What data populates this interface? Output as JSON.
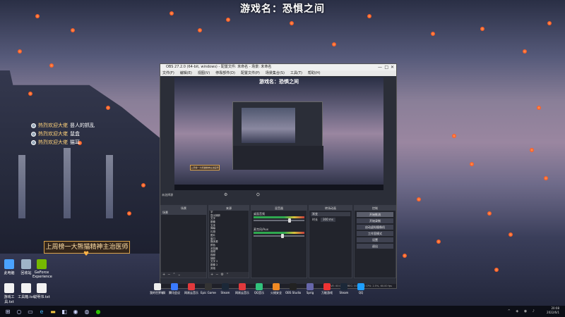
{
  "stream": {
    "top_title": "游戏名：恐惧之间",
    "banner_text": "上周榜一大熊猫精神主治医师",
    "banner_heart": "♥"
  },
  "chat": [
    {
      "user": "热烈欢迎大佬",
      "msg": "昙人的抓乱"
    },
    {
      "user": "热烈欢迎大佬",
      "msg": "鼠盒"
    },
    {
      "user": "热烈欢迎大佬",
      "msg": "猫耳"
    }
  ],
  "desktop_icons": [
    {
      "label": "此电脑",
      "color": "#4aa3ff"
    },
    {
      "label": "回收站",
      "color": "#9fb4c8"
    },
    {
      "label": "GeForce Experience",
      "color": "#76b900"
    },
    {
      "label": "游戏工具.txt",
      "color": "#f2f2f2"
    },
    {
      "label": "工具箱.txt",
      "color": "#f2f2f2"
    },
    {
      "label": "说明书.txt",
      "color": "#f2f2f2"
    }
  ],
  "obs": {
    "titlebar": "OBS 27.2.0 (64-bit, windows) - 配置文件: 未命名 - 场景: 未命名",
    "menu": [
      "文件(F)",
      "编辑(E)",
      "视图(V)",
      "停靠部件(D)",
      "配置文件(P)",
      "场景集合(S)",
      "工具(T)",
      "帮助(H)"
    ],
    "preview_title": "游戏名：恐惧之间",
    "status_left": "未选择源",
    "docks": {
      "scenes": {
        "title": "场景",
        "items": [
          "场景"
        ]
      },
      "sources": {
        "title": "来源",
        "items": [
          "字",
          "显示捕获",
          "文字",
          "图像",
          "文本",
          "弹幕",
          "礼物",
          "图片",
          "窗口",
          "媒体源",
          "颜色",
          "浏览器",
          "音频",
          "视频",
          "捕获",
          "文字 2",
          "图像 2",
          "其他"
        ]
      },
      "mixer": {
        "title": "混音器",
        "tracks": [
          {
            "name": "桌面音频",
            "level": 0.7
          },
          {
            "name": "麦克风/Aux",
            "level": 0.55
          }
        ]
      },
      "transitions": {
        "title": "转场动画",
        "fade": "渐变",
        "duration_label": "时长",
        "duration": "300 ms"
      },
      "controls": {
        "title": "控制",
        "buttons": [
          "开始推流",
          "开始录制",
          "启动虚拟摄像机",
          "工作室模式",
          "设置",
          "退出"
        ]
      }
    },
    "bottom_status": "LIVE: 00:00:00  REC: 00:00:00  CPU: 2.5%, 60.00 fps"
  },
  "dock_apps": [
    {
      "label": "我的世界辅助",
      "color": "#eee"
    },
    {
      "label": "腾讯会议",
      "color": "#3a7bff"
    },
    {
      "label": "网易云音乐",
      "color": "#e2393c"
    },
    {
      "label": "Epic Games Launcher",
      "color": "#333"
    },
    {
      "label": "Steam",
      "color": "#1b2838"
    },
    {
      "label": "网易云音乐",
      "color": "#e2393c"
    },
    {
      "label": "QQ音乐",
      "color": "#31c27c"
    },
    {
      "label": "火绒安全",
      "color": "#f08a24"
    },
    {
      "label": "OBS Studio",
      "color": "#222"
    },
    {
      "label": "Sprig",
      "color": "#66a"
    },
    {
      "label": "万能游戏",
      "color": "#e33"
    },
    {
      "label": "Steam",
      "color": "#1b2838"
    },
    {
      "label": "QQ",
      "color": "#1e9fff"
    }
  ],
  "taskbar": {
    "clock_time": "20:08",
    "clock_date": "2022/6/1",
    "icons": [
      "windows-icon",
      "search-icon",
      "task-view-icon",
      "edge-icon",
      "folder-icon",
      "store-icon",
      "obs-icon",
      "steam-icon",
      "wechat-icon"
    ]
  }
}
